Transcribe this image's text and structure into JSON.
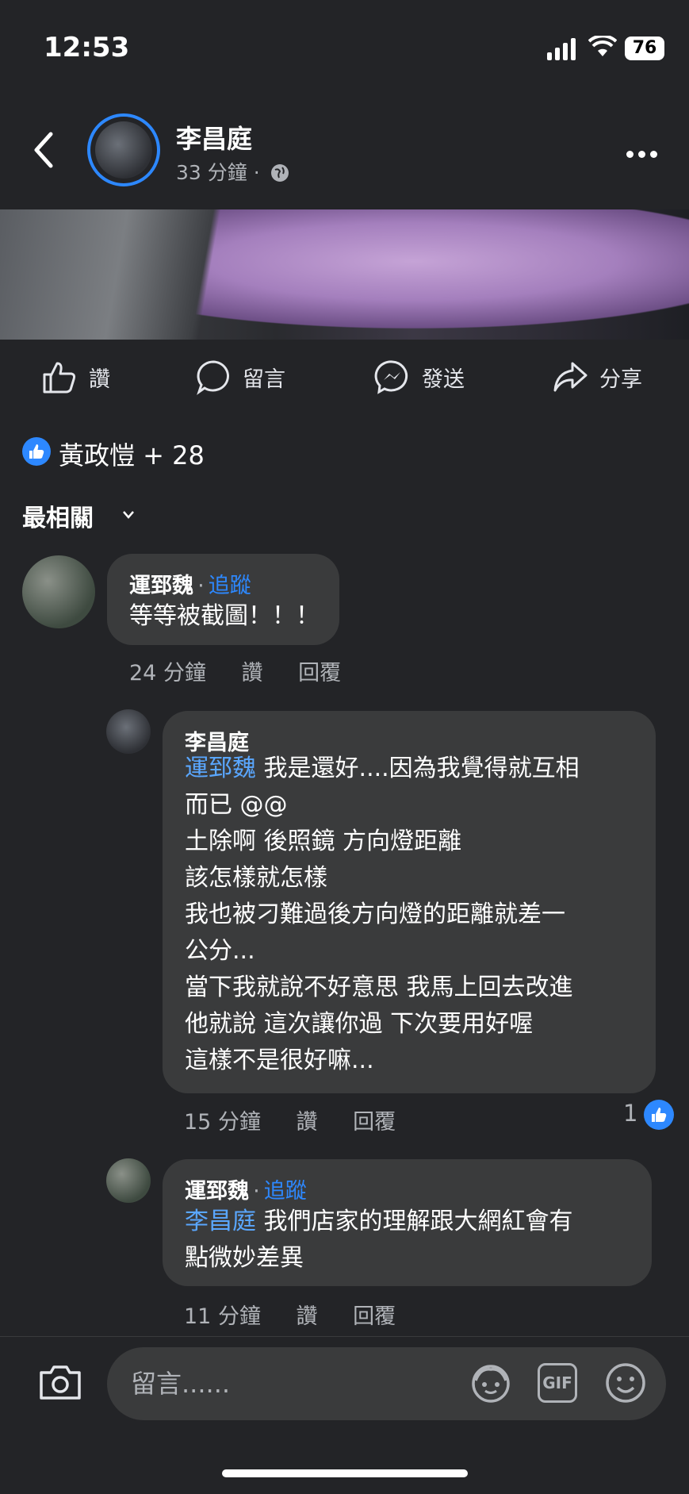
{
  "status_bar": {
    "time": "12:53",
    "battery": "76"
  },
  "post": {
    "author": "李昌庭",
    "time": "33 分鐘",
    "separator": "·",
    "audience_icon": "globe-icon"
  },
  "actions": {
    "like": "讚",
    "comment": "留言",
    "send": "發送",
    "share": "分享"
  },
  "reactions": {
    "summary": "黃政愷 + 28"
  },
  "sort": {
    "label": "最相關"
  },
  "comments": [
    {
      "name": "運郅魏",
      "follow": "追蹤",
      "text": "等等被截圖！！！",
      "time": "24 分鐘",
      "like": "讚",
      "reply": "回覆"
    },
    {
      "name": "李昌庭",
      "mention": "運郅魏",
      "text_line1": " 我是還好....因為我覺得就互相",
      "lines": [
        "而已 @@",
        "土除啊 後照鏡 方向燈距離",
        "該怎樣就怎樣",
        "我也被刁難過後方向燈的距離就差一",
        "公分...",
        "當下我就說不好意思 我馬上回去改進",
        "他就說 這次讓你過 下次要用好喔",
        "這樣不是很好嘛..."
      ],
      "time": "15 分鐘",
      "like": "讚",
      "reply": "回覆",
      "like_count": "1"
    },
    {
      "name": "運郅魏",
      "follow": "追蹤",
      "mention": "李昌庭",
      "text_line1": " 我們店家的理解跟大網紅會有",
      "text_line2": "點微妙差異",
      "time": "11 分鐘",
      "like": "讚",
      "reply": "回覆"
    }
  ],
  "composer": {
    "placeholder": "留言......",
    "gif": "GIF"
  }
}
